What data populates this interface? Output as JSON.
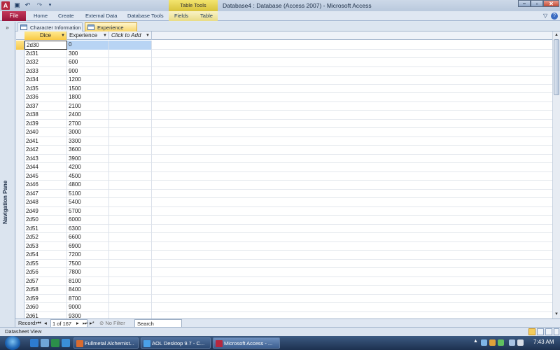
{
  "window": {
    "title": "Database4 : Database (Access 2007)  -  Microsoft Access",
    "app_icon": "A",
    "contextual_tab_group": "Table Tools"
  },
  "ribbon": {
    "tabs": [
      "File",
      "Home",
      "Create",
      "External Data",
      "Database Tools",
      "Fields",
      "Table"
    ]
  },
  "nav_pane": {
    "label": "Navigation Pane"
  },
  "doc_tabs": [
    "Character Information",
    "Experience"
  ],
  "datasheet": {
    "columns": [
      "Dice",
      "Experience",
      "Click to Add"
    ],
    "rows": [
      [
        "2d30",
        "0"
      ],
      [
        "2d31",
        "300"
      ],
      [
        "2d32",
        "600"
      ],
      [
        "2d33",
        "900"
      ],
      [
        "2d34",
        "1200"
      ],
      [
        "2d35",
        "1500"
      ],
      [
        "2d36",
        "1800"
      ],
      [
        "2d37",
        "2100"
      ],
      [
        "2d38",
        "2400"
      ],
      [
        "2d39",
        "2700"
      ],
      [
        "2d40",
        "3000"
      ],
      [
        "2d41",
        "3300"
      ],
      [
        "2d42",
        "3600"
      ],
      [
        "2d43",
        "3900"
      ],
      [
        "2d44",
        "4200"
      ],
      [
        "2d45",
        "4500"
      ],
      [
        "2d46",
        "4800"
      ],
      [
        "2d47",
        "5100"
      ],
      [
        "2d48",
        "5400"
      ],
      [
        "2d49",
        "5700"
      ],
      [
        "2d50",
        "6000"
      ],
      [
        "2d51",
        "6300"
      ],
      [
        "2d52",
        "6600"
      ],
      [
        "2d53",
        "6900"
      ],
      [
        "2d54",
        "7200"
      ],
      [
        "2d55",
        "7500"
      ],
      [
        "2d56",
        "7800"
      ],
      [
        "2d57",
        "8100"
      ],
      [
        "2d58",
        "8400"
      ],
      [
        "2d59",
        "8700"
      ],
      [
        "2d60",
        "9000"
      ],
      [
        "2d61",
        "9300"
      ]
    ]
  },
  "record_nav": {
    "label": "Record:",
    "current": "1 of 167",
    "filter": "No Filter",
    "search": "Search"
  },
  "status": {
    "text": "Datasheet View"
  },
  "taskbar": {
    "tasks": [
      "Fullmetal Alchemist...",
      "AOL Desktop 9.7 - C...",
      "Microsoft Access - ..."
    ],
    "clock": "7:43 AM"
  },
  "icons": {
    "save": "save-icon",
    "undo": "undo-icon",
    "redo": "redo-icon",
    "table": "table-icon",
    "start": "windows-start-icon"
  },
  "colors": {
    "file_tab": "#b5283f",
    "contextual_tab": "#e9d44c",
    "selected_field_header": "#f8c945",
    "selected_row_fill": "#b8d4f4"
  }
}
